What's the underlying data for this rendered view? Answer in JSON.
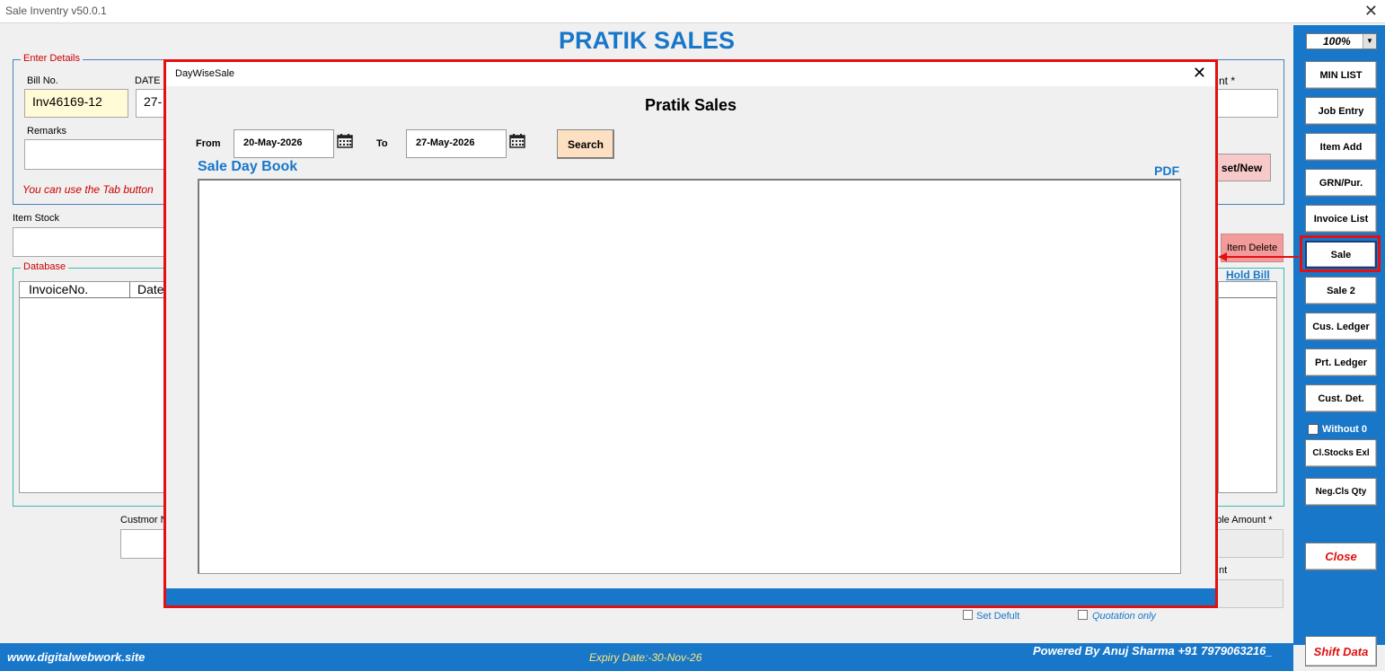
{
  "window": {
    "title": "Sale Inventry v50.0.1",
    "close_glyph": "✕"
  },
  "brand": "PRATIK SALES",
  "zoom": "100%",
  "enter_details": {
    "legend": "Enter Details",
    "bill_no_label": "Bill No.",
    "bill_no_value": "Inv46169-12",
    "date_label": "DATE",
    "date_value": "27-",
    "remarks_label": "Remarks",
    "hint": "You can use the Tab button",
    "right_label_fragment": "nt *",
    "reset_button": "set/New"
  },
  "item_stock_label": "Item Stock",
  "item_delete_button": "Item Delete",
  "hold_bill": "Hold Bill",
  "database": {
    "legend": "Database",
    "columns": [
      "InvoiceNo.",
      "Date"
    ]
  },
  "customer_label": "Custmor N",
  "payable_label": "able Amount *",
  "amount_label_fragment": "nt",
  "checkboxes": {
    "set_default": "Set Defult",
    "quotation_only": "Quotation only",
    "without_zero": "Without 0"
  },
  "sidebar": {
    "buttons": [
      "MIN LIST",
      "Job Entry",
      "Item Add",
      "GRN/Pur.",
      "Invoice List",
      "Sale",
      "Sale 2",
      "Cus. Ledger",
      "Prt. Ledger",
      "Cust. Det."
    ],
    "cl_stocks": "Cl.Stocks Exl",
    "neg_cls": "Neg.Cls Qty",
    "close": "Close",
    "shift_data": "Shift Data"
  },
  "footer": {
    "site": "www.digitalwebwork.site",
    "expiry": "Expiry Date:-30-Nov-26",
    "powered": "Powered By Anuj Sharma +91 7979063216_"
  },
  "dialog": {
    "title": "DayWiseSale",
    "heading": "Pratik Sales",
    "from_label": "From",
    "from_value": "20-May-2026",
    "to_label": "To",
    "to_value": "27-May-2026",
    "search_button": "Search",
    "section_title": "Sale Day Book",
    "pdf_link": "PDF"
  },
  "colors": {
    "accent": "#1877c9",
    "highlight": "#e21010"
  }
}
